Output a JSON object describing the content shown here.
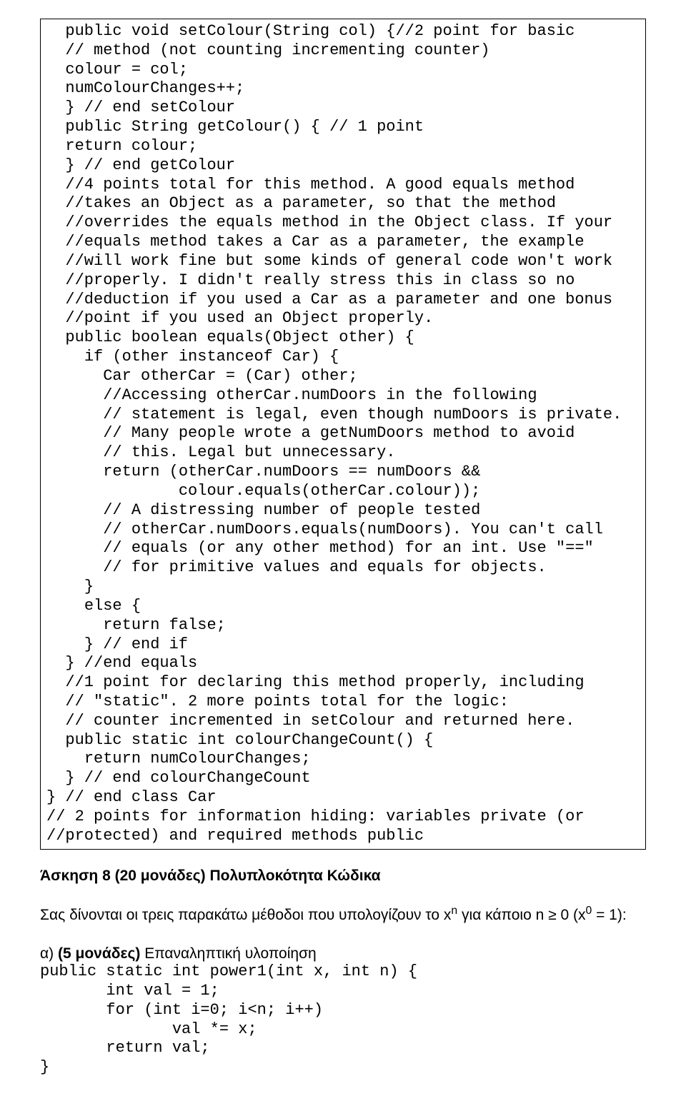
{
  "code_block": "  public void setColour(String col) {//2 point for basic\n  // method (not counting incrementing counter)\n  colour = col;\n  numColourChanges++;\n  } // end setColour\n  public String getColour() { // 1 point\n  return colour;\n  } // end getColour\n  //4 points total for this method. A good equals method\n  //takes an Object as a parameter, so that the method\n  //overrides the equals method in the Object class. If your\n  //equals method takes a Car as a parameter, the example\n  //will work fine but some kinds of general code won't work\n  //properly. I didn't really stress this in class so no\n  //deduction if you used a Car as a parameter and one bonus\n  //point if you used an Object properly.\n  public boolean equals(Object other) {\n    if (other instanceof Car) {\n      Car otherCar = (Car) other;\n      //Accessing otherCar.numDoors in the following\n      // statement is legal, even though numDoors is private.\n      // Many people wrote a getNumDoors method to avoid\n      // this. Legal but unnecessary.\n      return (otherCar.numDoors == numDoors &&\n              colour.equals(otherCar.colour));\n      // A distressing number of people tested\n      // otherCar.numDoors.equals(numDoors). You can't call\n      // equals (or any other method) for an int. Use \"==\"\n      // for primitive values and equals for objects.\n    }\n    else {\n      return false;\n    } // end if\n  } //end equals\n  //1 point for declaring this method properly, including\n  // \"static\". 2 more points total for the logic:\n  // counter incremented in setColour and returned here.\n  public static int colourChangeCount() {\n    return numColourChanges;\n  } // end colourChangeCount\n} // end class Car\n// 2 points for information hiding: variables private (or\n//protected) and required methods public",
  "heading": "Άσκηση 8 (20 μονάδες) Πολυπλοκότητα Κώδικα",
  "body_para_prefix": "Σας δίνονται οι τρεις παρακάτω μέθοδοι που υπολογίζουν το x",
  "body_para_mid": " για κάποιο n ≥ 0 (x",
  "body_para_suffix": " = 1):",
  "sup_n": "n",
  "sup_0": "0",
  "sub_heading_prefix": "α) ",
  "sub_heading_bold": "(5 μονάδες)",
  "sub_heading_rest": " Επαναληπτική υλοποίηση",
  "code_free": "public static int power1(int x, int n) {\n       int val = 1;\n       for (int i=0; i<n; i++)\n              val *= x;\n       return val;\n}"
}
